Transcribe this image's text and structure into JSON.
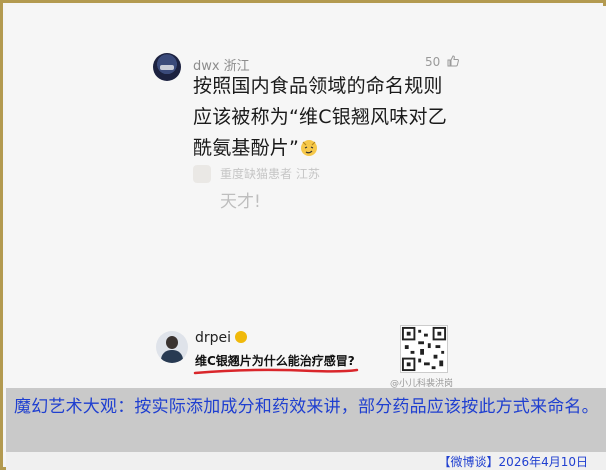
{
  "comment": {
    "username": "dwx",
    "location": "浙江",
    "likes": "50",
    "text": "按照国内食品领域的命名规则应该被称为“维C银翘风味对乙酰氨基酚片”"
  },
  "reply": {
    "username": "重度缺猫患者",
    "location": "江苏",
    "text": "天才!"
  },
  "watermark": {
    "name": "drpei",
    "title": "维C银翘片为什么能治疗感冒?",
    "qr_caption": "@小儿科裴洪岗"
  },
  "caption": {
    "text": "魔幻艺术大观：按实际添加成分和药效来讲，部分药品应该按此方式来命名。",
    "source": "【微博谈】2026年4月10日"
  },
  "colors": {
    "border": "#b39a50",
    "caption_text": "#1f3fd0",
    "caption_band": "#c9c9c9",
    "underline": "#d9262b",
    "verify_badge": "#f0b90b"
  },
  "icons": [
    "thumbs-up-icon",
    "verified-badge-icon",
    "emoji-icon",
    "qr-code-icon"
  ]
}
